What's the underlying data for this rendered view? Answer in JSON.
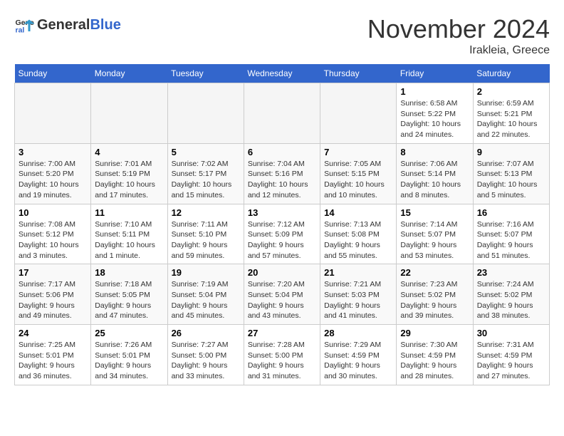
{
  "header": {
    "logo_general": "General",
    "logo_blue": "Blue",
    "month_title": "November 2024",
    "location": "Irakleia, Greece"
  },
  "weekdays": [
    "Sunday",
    "Monday",
    "Tuesday",
    "Wednesday",
    "Thursday",
    "Friday",
    "Saturday"
  ],
  "weeks": [
    [
      {
        "day": "",
        "empty": true
      },
      {
        "day": "",
        "empty": true
      },
      {
        "day": "",
        "empty": true
      },
      {
        "day": "",
        "empty": true
      },
      {
        "day": "",
        "empty": true
      },
      {
        "day": "1",
        "sunrise": "Sunrise: 6:58 AM",
        "sunset": "Sunset: 5:22 PM",
        "daylight": "Daylight: 10 hours and 24 minutes."
      },
      {
        "day": "2",
        "sunrise": "Sunrise: 6:59 AM",
        "sunset": "Sunset: 5:21 PM",
        "daylight": "Daylight: 10 hours and 22 minutes."
      }
    ],
    [
      {
        "day": "3",
        "sunrise": "Sunrise: 7:00 AM",
        "sunset": "Sunset: 5:20 PM",
        "daylight": "Daylight: 10 hours and 19 minutes."
      },
      {
        "day": "4",
        "sunrise": "Sunrise: 7:01 AM",
        "sunset": "Sunset: 5:19 PM",
        "daylight": "Daylight: 10 hours and 17 minutes."
      },
      {
        "day": "5",
        "sunrise": "Sunrise: 7:02 AM",
        "sunset": "Sunset: 5:17 PM",
        "daylight": "Daylight: 10 hours and 15 minutes."
      },
      {
        "day": "6",
        "sunrise": "Sunrise: 7:04 AM",
        "sunset": "Sunset: 5:16 PM",
        "daylight": "Daylight: 10 hours and 12 minutes."
      },
      {
        "day": "7",
        "sunrise": "Sunrise: 7:05 AM",
        "sunset": "Sunset: 5:15 PM",
        "daylight": "Daylight: 10 hours and 10 minutes."
      },
      {
        "day": "8",
        "sunrise": "Sunrise: 7:06 AM",
        "sunset": "Sunset: 5:14 PM",
        "daylight": "Daylight: 10 hours and 8 minutes."
      },
      {
        "day": "9",
        "sunrise": "Sunrise: 7:07 AM",
        "sunset": "Sunset: 5:13 PM",
        "daylight": "Daylight: 10 hours and 5 minutes."
      }
    ],
    [
      {
        "day": "10",
        "sunrise": "Sunrise: 7:08 AM",
        "sunset": "Sunset: 5:12 PM",
        "daylight": "Daylight: 10 hours and 3 minutes."
      },
      {
        "day": "11",
        "sunrise": "Sunrise: 7:10 AM",
        "sunset": "Sunset: 5:11 PM",
        "daylight": "Daylight: 10 hours and 1 minute."
      },
      {
        "day": "12",
        "sunrise": "Sunrise: 7:11 AM",
        "sunset": "Sunset: 5:10 PM",
        "daylight": "Daylight: 9 hours and 59 minutes."
      },
      {
        "day": "13",
        "sunrise": "Sunrise: 7:12 AM",
        "sunset": "Sunset: 5:09 PM",
        "daylight": "Daylight: 9 hours and 57 minutes."
      },
      {
        "day": "14",
        "sunrise": "Sunrise: 7:13 AM",
        "sunset": "Sunset: 5:08 PM",
        "daylight": "Daylight: 9 hours and 55 minutes."
      },
      {
        "day": "15",
        "sunrise": "Sunrise: 7:14 AM",
        "sunset": "Sunset: 5:07 PM",
        "daylight": "Daylight: 9 hours and 53 minutes."
      },
      {
        "day": "16",
        "sunrise": "Sunrise: 7:16 AM",
        "sunset": "Sunset: 5:07 PM",
        "daylight": "Daylight: 9 hours and 51 minutes."
      }
    ],
    [
      {
        "day": "17",
        "sunrise": "Sunrise: 7:17 AM",
        "sunset": "Sunset: 5:06 PM",
        "daylight": "Daylight: 9 hours and 49 minutes."
      },
      {
        "day": "18",
        "sunrise": "Sunrise: 7:18 AM",
        "sunset": "Sunset: 5:05 PM",
        "daylight": "Daylight: 9 hours and 47 minutes."
      },
      {
        "day": "19",
        "sunrise": "Sunrise: 7:19 AM",
        "sunset": "Sunset: 5:04 PM",
        "daylight": "Daylight: 9 hours and 45 minutes."
      },
      {
        "day": "20",
        "sunrise": "Sunrise: 7:20 AM",
        "sunset": "Sunset: 5:04 PM",
        "daylight": "Daylight: 9 hours and 43 minutes."
      },
      {
        "day": "21",
        "sunrise": "Sunrise: 7:21 AM",
        "sunset": "Sunset: 5:03 PM",
        "daylight": "Daylight: 9 hours and 41 minutes."
      },
      {
        "day": "22",
        "sunrise": "Sunrise: 7:23 AM",
        "sunset": "Sunset: 5:02 PM",
        "daylight": "Daylight: 9 hours and 39 minutes."
      },
      {
        "day": "23",
        "sunrise": "Sunrise: 7:24 AM",
        "sunset": "Sunset: 5:02 PM",
        "daylight": "Daylight: 9 hours and 38 minutes."
      }
    ],
    [
      {
        "day": "24",
        "sunrise": "Sunrise: 7:25 AM",
        "sunset": "Sunset: 5:01 PM",
        "daylight": "Daylight: 9 hours and 36 minutes."
      },
      {
        "day": "25",
        "sunrise": "Sunrise: 7:26 AM",
        "sunset": "Sunset: 5:01 PM",
        "daylight": "Daylight: 9 hours and 34 minutes."
      },
      {
        "day": "26",
        "sunrise": "Sunrise: 7:27 AM",
        "sunset": "Sunset: 5:00 PM",
        "daylight": "Daylight: 9 hours and 33 minutes."
      },
      {
        "day": "27",
        "sunrise": "Sunrise: 7:28 AM",
        "sunset": "Sunset: 5:00 PM",
        "daylight": "Daylight: 9 hours and 31 minutes."
      },
      {
        "day": "28",
        "sunrise": "Sunrise: 7:29 AM",
        "sunset": "Sunset: 4:59 PM",
        "daylight": "Daylight: 9 hours and 30 minutes."
      },
      {
        "day": "29",
        "sunrise": "Sunrise: 7:30 AM",
        "sunset": "Sunset: 4:59 PM",
        "daylight": "Daylight: 9 hours and 28 minutes."
      },
      {
        "day": "30",
        "sunrise": "Sunrise: 7:31 AM",
        "sunset": "Sunset: 4:59 PM",
        "daylight": "Daylight: 9 hours and 27 minutes."
      }
    ]
  ]
}
